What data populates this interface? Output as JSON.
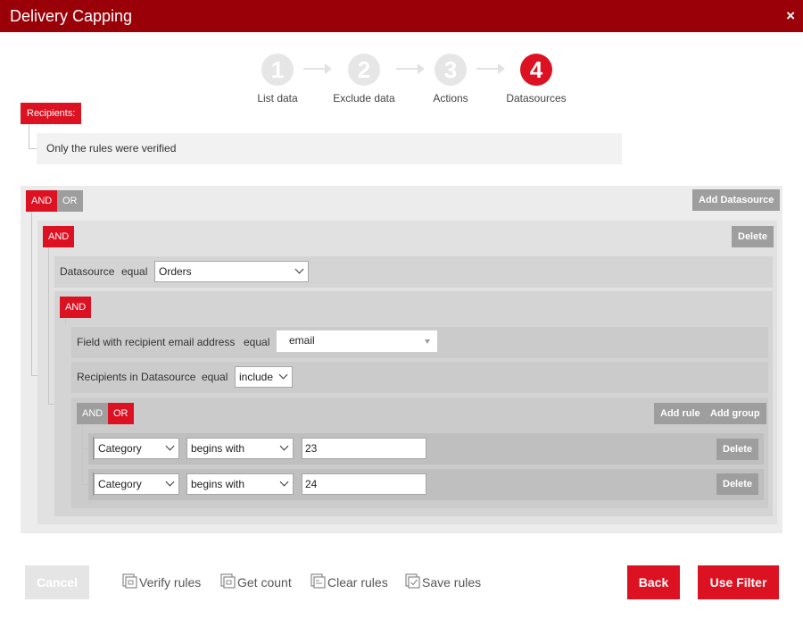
{
  "dialog": {
    "title": "Delivery Capping",
    "close_glyph": "×"
  },
  "stepper": {
    "steps": [
      {
        "number": "1",
        "label": "List data",
        "active": false
      },
      {
        "number": "2",
        "label": "Exclude data",
        "active": false
      },
      {
        "number": "3",
        "label": "Actions",
        "active": false
      },
      {
        "number": "4",
        "label": "Datasources",
        "active": true
      }
    ]
  },
  "recipients": {
    "chip_label": "Recipients:",
    "verification_text": "Only the rules were verified"
  },
  "rules": {
    "root": {
      "and_label": "AND",
      "or_label": "OR",
      "selected": "AND",
      "add_datasource_label": "Add Datasource"
    },
    "datasource_group": {
      "and_label": "AND",
      "delete_label": "Delete",
      "datasource_rule": {
        "field": "Datasource",
        "operator": "equal",
        "value": "Orders"
      },
      "inner_group": {
        "and_label": "AND",
        "email_rule": {
          "field": "Field with recipient email address",
          "operator": "equal",
          "value": "email"
        },
        "recipients_rule": {
          "field": "Recipients in Datasource",
          "operator": "equal",
          "value": "include"
        },
        "category_group": {
          "and_label": "AND",
          "or_label": "OR",
          "selected": "OR",
          "add_rule_label": "Add rule",
          "add_group_label": "Add group",
          "conditions": [
            {
              "field": "Category",
              "operator": "begins with",
              "value": "23",
              "delete_label": "Delete"
            },
            {
              "field": "Category",
              "operator": "begins with",
              "value": "24",
              "delete_label": "Delete"
            }
          ]
        }
      }
    }
  },
  "footer": {
    "cancel_label": "Cancel",
    "verify_label": "Verify rules",
    "count_label": "Get count",
    "clear_label": "Clear rules",
    "save_label": "Save rules",
    "back_label": "Back",
    "use_filter_label": "Use Filter"
  },
  "colors": {
    "brand_red": "#dc1222",
    "header_red": "#9a0007",
    "neutral_grey": "#9e9e9e"
  }
}
